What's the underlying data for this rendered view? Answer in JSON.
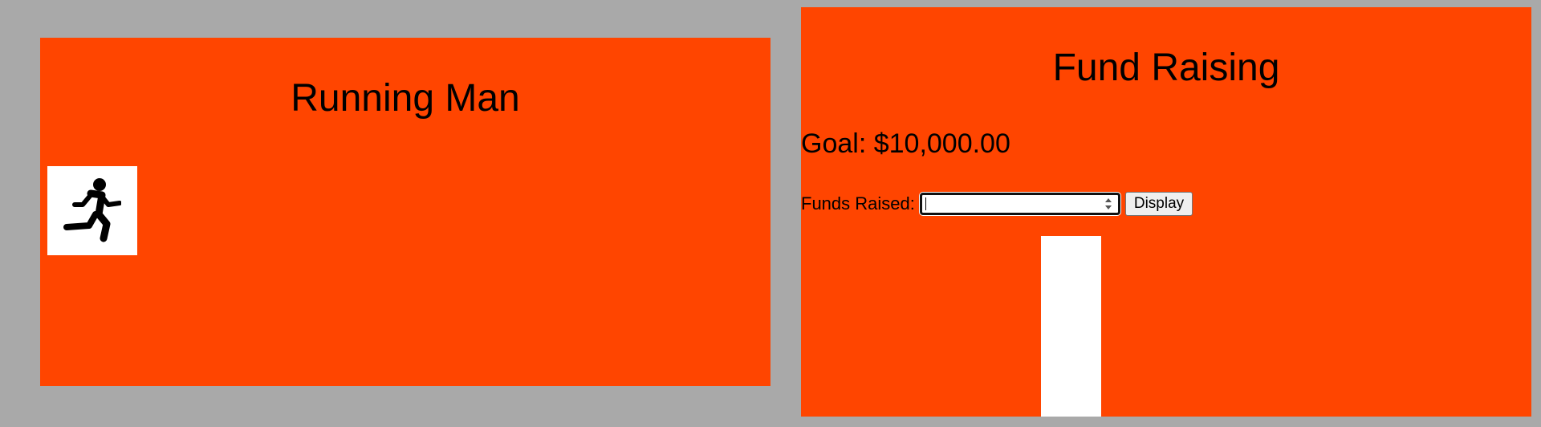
{
  "running": {
    "title": "Running Man"
  },
  "fund": {
    "title": "Fund Raising",
    "goal_text": "Goal: $10,000.00",
    "funds_label": "Funds Raised:",
    "funds_input_value": "",
    "display_label": "Display"
  },
  "colors": {
    "background": "#a9a9a9",
    "panel": "#ff4500",
    "box": "#ffffff"
  }
}
